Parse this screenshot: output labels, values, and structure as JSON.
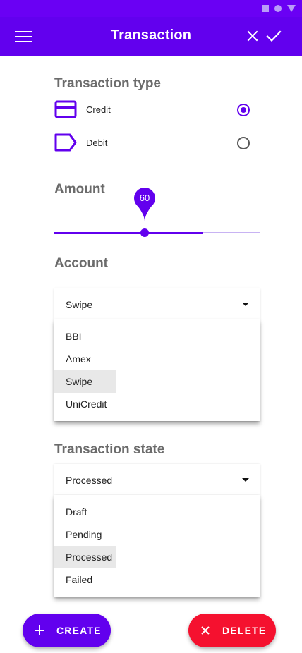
{
  "app": {
    "title": "Transaction",
    "accent_color": "#6200ee",
    "danger_color": "#f5112f"
  },
  "status_bar": {
    "icons": [
      "square-icon",
      "circle-icon",
      "triangle-icon"
    ]
  },
  "header": {
    "menu_icon": "menu-icon",
    "close_icon": "close-icon",
    "confirm_icon": "check-icon"
  },
  "transaction_type": {
    "title": "Transaction type",
    "options": [
      {
        "label": "Credit",
        "icon": "credit-card-icon",
        "selected": true
      },
      {
        "label": "Debit",
        "icon": "label-tag-icon",
        "selected": false
      }
    ]
  },
  "amount": {
    "title": "Amount",
    "value": "60",
    "fraction": 0.72,
    "thumb_fraction": 0.44
  },
  "account": {
    "title": "Account",
    "selected": "Swipe",
    "options": [
      "BBI",
      "Amex",
      "Swipe",
      "UniCredit"
    ]
  },
  "transaction_state": {
    "title": "Transaction state",
    "selected": "Processed",
    "options": [
      "Draft",
      "Pending",
      "Processed",
      "Failed"
    ]
  },
  "actions": {
    "create_label": "CREATE",
    "create_icon": "plus-icon",
    "delete_label": "DELETE",
    "delete_icon": "close-icon"
  }
}
